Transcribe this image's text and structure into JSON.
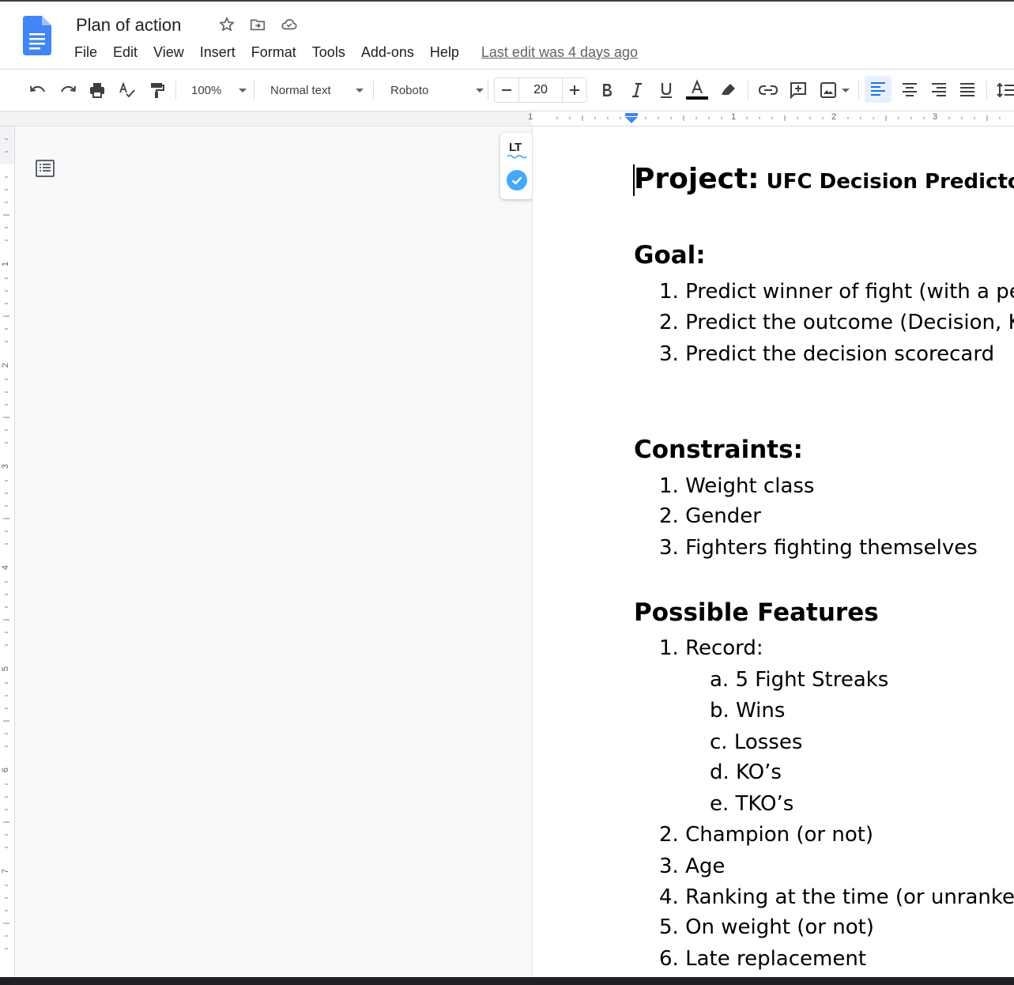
{
  "header": {
    "title": "Plan of action",
    "menu": [
      "File",
      "Edit",
      "View",
      "Insert",
      "Format",
      "Tools",
      "Add-ons",
      "Help"
    ],
    "last_edit": "Last edit was 4 days ago"
  },
  "toolbar": {
    "zoom": "100%",
    "style": "Normal text",
    "font": "Roboto",
    "font_size": "20",
    "text_color": "#000000"
  },
  "ruler": {
    "labels": [
      "1",
      "1",
      "2",
      "3"
    ]
  },
  "vruler": {
    "labels": [
      "1",
      "2",
      "3",
      "4",
      "5",
      "6",
      "7"
    ]
  },
  "lt_widget": {
    "logo": "LT"
  },
  "document": {
    "project_label": "Project:",
    "project_name": "UFC Decision Predictor ML",
    "goal": {
      "heading": "Goal:",
      "items": [
        {
          "num": "1.",
          "text": "Predict winner of fight (with a per"
        },
        {
          "num": "2.",
          "text": "Predict the outcome (Decision, KO"
        },
        {
          "num": "3.",
          "text": "Predict the decision scorecard"
        }
      ]
    },
    "constraints": {
      "heading": "Constraints:",
      "items": [
        {
          "num": "1.",
          "text": "Weight class"
        },
        {
          "num": "2.",
          "text": "Gender"
        },
        {
          "num": "3.",
          "text": "Fighters fighting themselves"
        }
      ]
    },
    "features": {
      "heading": "Possible Features",
      "items": [
        {
          "num": "1.",
          "text": "Record:"
        },
        {
          "num": "a.",
          "text": "5 Fight Streaks"
        },
        {
          "num": "b.",
          "text": "Wins"
        },
        {
          "num": "c.",
          "text": "Losses"
        },
        {
          "num": "d.",
          "text": "KO’s"
        },
        {
          "num": "e.",
          "text": "TKO’s"
        },
        {
          "num": "2.",
          "text": "Champion (or not)"
        },
        {
          "num": "3.",
          "text": "Age"
        },
        {
          "num": "4.",
          "text": "Ranking at the time (or unranked)"
        },
        {
          "num": "5.",
          "text": "On weight (or not)"
        },
        {
          "num": "6.",
          "text": "Late replacement"
        }
      ]
    }
  }
}
